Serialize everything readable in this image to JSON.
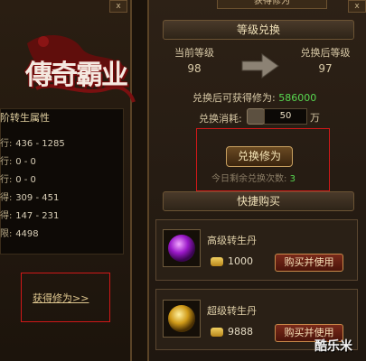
{
  "left": {
    "close": "x",
    "logo_text": "傳奇霸业",
    "attr_title": "阶转生属性",
    "attrs": [
      {
        "label": "行:",
        "value": "436 - 1285"
      },
      {
        "label": "行:",
        "value": "0 - 0"
      },
      {
        "label": "行:",
        "value": "0 - 0"
      },
      {
        "label": "得:",
        "value": "309 - 451"
      },
      {
        "label": "得:",
        "value": "147 - 231"
      },
      {
        "label": "限:",
        "value": "4498"
      }
    ],
    "get_link": "获得修为>>"
  },
  "right": {
    "top_title": "获得修为",
    "close": "x",
    "level_section": {
      "header": "等级兑换",
      "current_label": "当前等级",
      "current_value": "98",
      "after_label": "兑换后等级",
      "after_value": "97",
      "exp_label": "兑换后可获得修为:",
      "exp_value": "586000",
      "cost_label": "兑换消耗:",
      "cost_value": "50",
      "cost_unit": "万",
      "exchange_button": "兑换修为",
      "remain_label": "今日剩余兑换次数:",
      "remain_value": "3"
    },
    "quick_section": {
      "header": "快捷购买",
      "items": [
        {
          "name": "高级转生丹",
          "price": "1000",
          "buy": "购买并使用",
          "icon": "purple-orb-icon"
        },
        {
          "name": "超级转生丹",
          "price": "9888",
          "buy": "购买并使用",
          "icon": "gold-orb-icon"
        }
      ]
    }
  },
  "watermark": "酷乐米",
  "colors": {
    "accent_green": "#58d850",
    "highlight_red": "#d01818",
    "gold": "#e0c890"
  }
}
